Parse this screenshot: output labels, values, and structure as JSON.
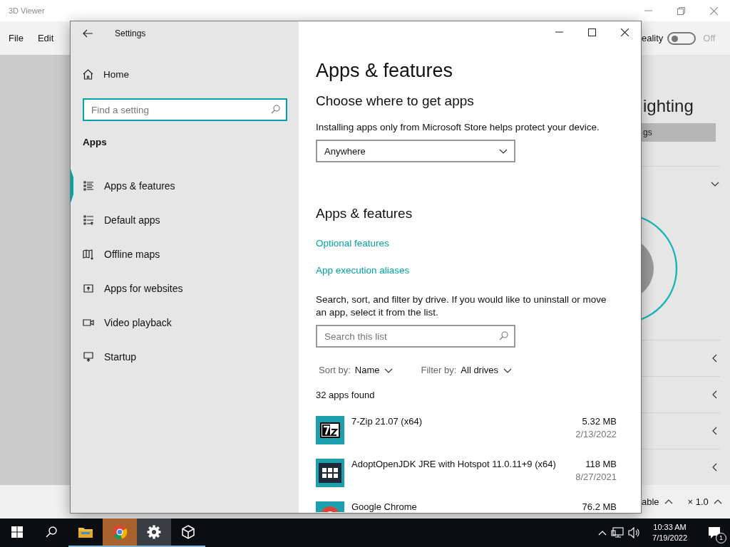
{
  "viewer": {
    "title": "3D Viewer",
    "menu": [
      "File",
      "Edit"
    ],
    "mixed_reality": {
      "label": "eality",
      "on": false,
      "state": "Off"
    },
    "lighting_heading": "ighting",
    "settings_button": "gs",
    "bottom": [
      "able",
      "× 1.0"
    ]
  },
  "settings": {
    "title": "Settings",
    "home": "Home",
    "search": {
      "placeholder": "Find a setting"
    },
    "section": "Apps",
    "nav": [
      {
        "label": "Apps & features",
        "kind": "list",
        "selected": true
      },
      {
        "label": "Default apps",
        "kind": "default",
        "selected": false
      },
      {
        "label": "Offline maps",
        "kind": "map",
        "selected": false
      },
      {
        "label": "Apps for websites",
        "kind": "web",
        "selected": false
      },
      {
        "label": "Video playback",
        "kind": "video",
        "selected": false
      },
      {
        "label": "Startup",
        "kind": "startup",
        "selected": false
      }
    ],
    "page_title": "Apps & features",
    "choose": {
      "heading": "Choose where to get apps",
      "description": "Installing apps only from Microsoft Store helps protect your device.",
      "dropdown": "Anywhere"
    },
    "features": {
      "heading": "Apps & features",
      "links": [
        "Optional features",
        "App execution aliases"
      ],
      "description": "Search, sort, and filter by drive. If you would like to uninstall or move an app, select it from the list.",
      "search": {
        "placeholder": "Search this list"
      },
      "sort": {
        "label": "Sort by:",
        "value": "Name"
      },
      "filter": {
        "label": "Filter by:",
        "value": "All drives"
      },
      "count": "32 apps found",
      "apps": [
        {
          "kind": "archive",
          "name": "7-Zip 21.07 (x64)",
          "size": "5.32 MB",
          "date": "2/13/2022"
        },
        {
          "kind": "jdk",
          "name": "AdoptOpenJDK JRE with Hotspot 11.0.11+9 (x64)",
          "size": "118 MB",
          "date": "8/27/2021"
        },
        {
          "kind": "chrome",
          "name": "Google Chrome",
          "size": "76.2 MB"
        }
      ]
    }
  },
  "taskbar": {
    "apps": [
      {
        "kind": "explorer",
        "flashing": false,
        "active": false
      },
      {
        "kind": "chrome",
        "flashing": true,
        "active": false
      },
      {
        "kind": "settings",
        "flashing": false,
        "active": true
      },
      {
        "kind": "viewer3d",
        "flashing": false,
        "active": false
      }
    ],
    "time": "10:33 AM",
    "date": "7/19/2022",
    "notifications": "1"
  }
}
